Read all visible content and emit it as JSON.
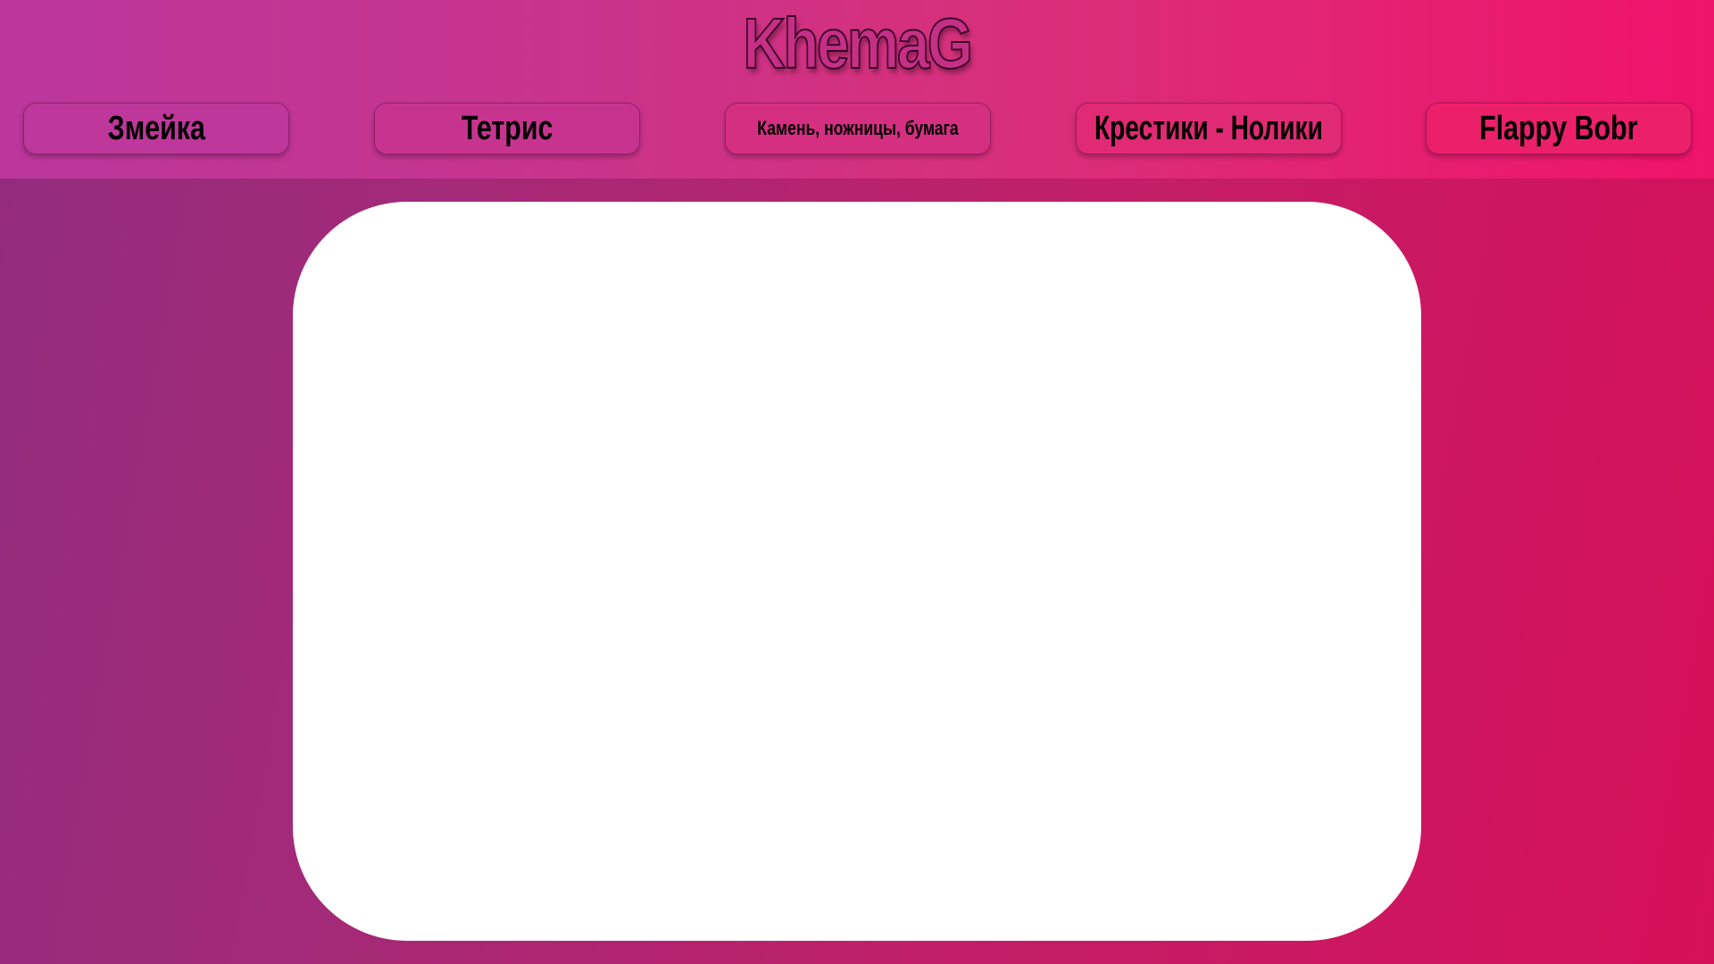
{
  "site": {
    "title": "KhemaG"
  },
  "nav": {
    "items": [
      {
        "label": "Змейка"
      },
      {
        "label": "Тетрис"
      },
      {
        "label": "Камень, ножницы, бумага"
      },
      {
        "label": "Крестики - Нолики"
      },
      {
        "label": "Flappy Bobr"
      }
    ]
  },
  "colors": {
    "header_gradient_start": "#bb379c",
    "header_gradient_end": "#f0136a",
    "background_gradient_start": "#932c7e",
    "background_gradient_end": "#d60f5a",
    "panel": "#ffffff"
  }
}
